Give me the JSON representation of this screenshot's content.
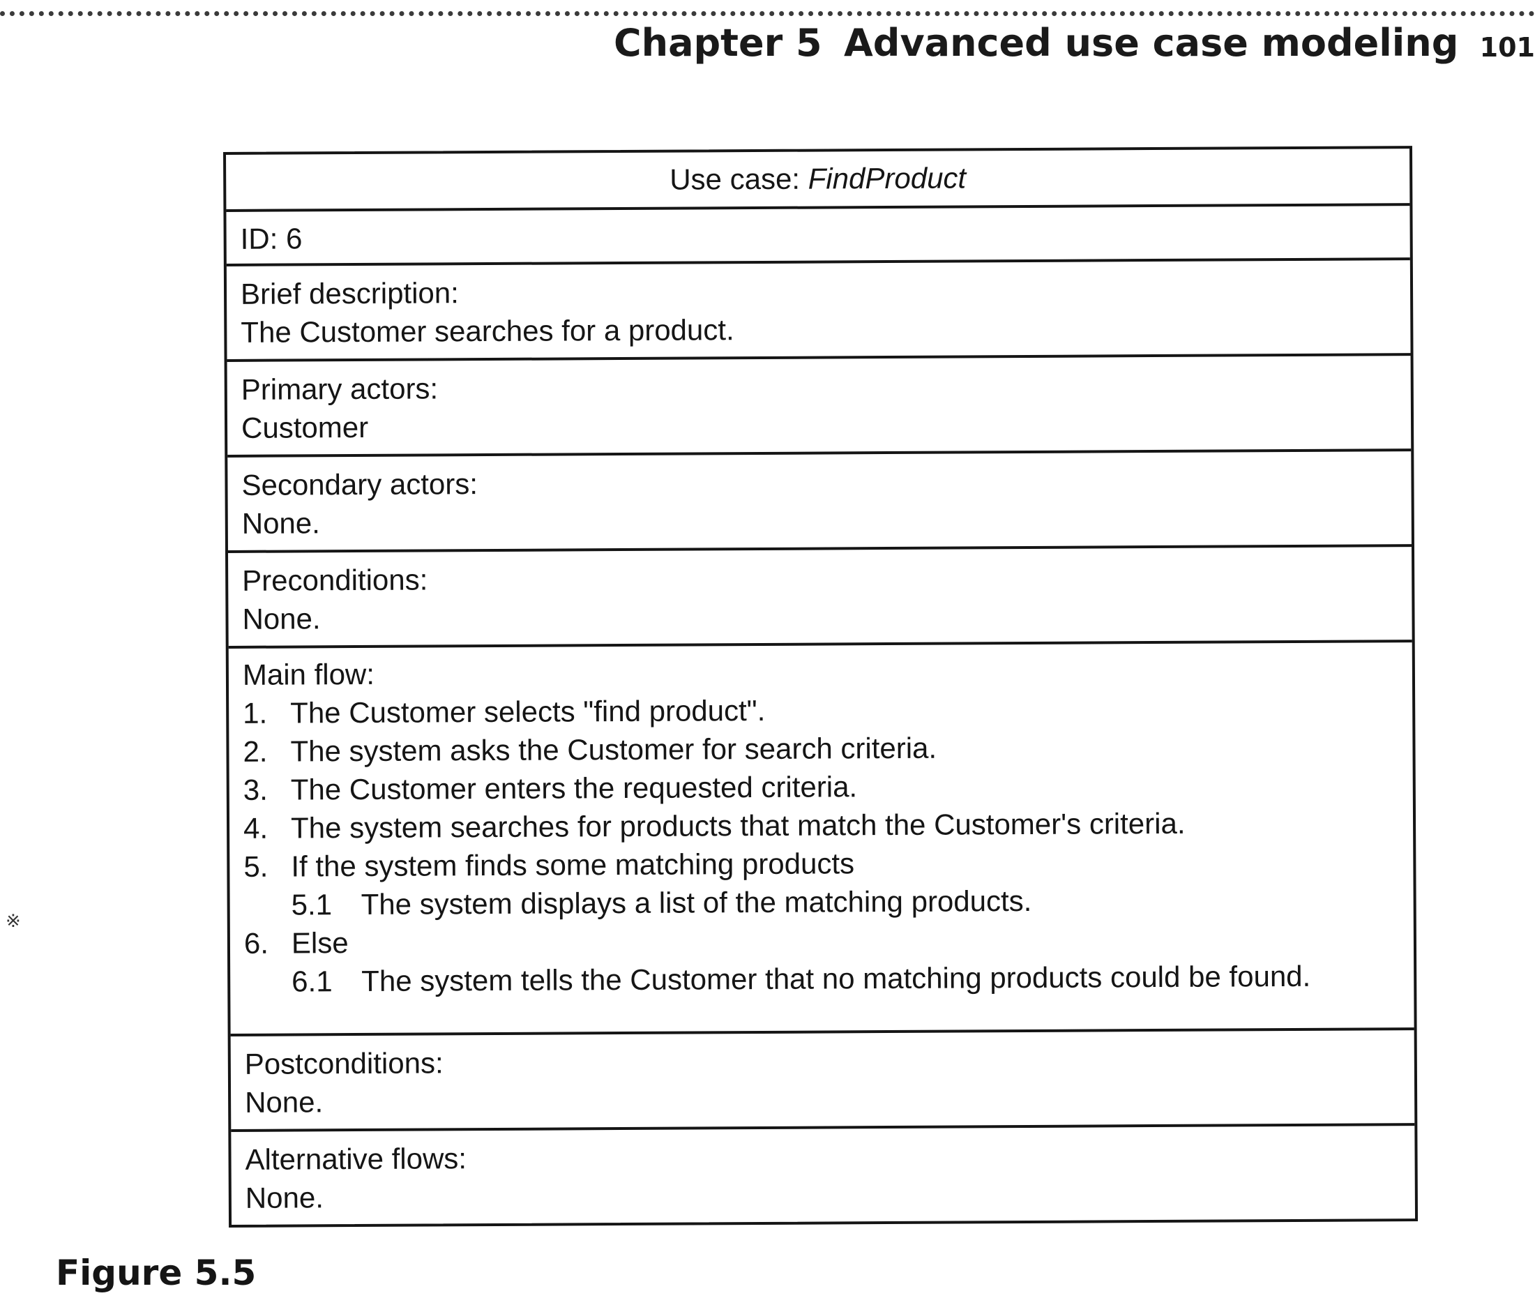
{
  "header": {
    "chapter": "Chapter 5",
    "title": "Advanced use case modeling",
    "page_number": "101"
  },
  "use_case": {
    "title_prefix": "Use case: ",
    "name": "FindProduct",
    "id": "ID: 6",
    "brief_description": {
      "label": "Brief description:",
      "value": "The Customer searches for a product."
    },
    "primary_actors": {
      "label": "Primary actors:",
      "value": "Customer"
    },
    "secondary_actors": {
      "label": "Secondary actors:",
      "value": "None."
    },
    "preconditions": {
      "label": "Preconditions:",
      "value": "None."
    },
    "main_flow": {
      "label": "Main flow:",
      "steps": [
        {
          "num": "1.",
          "text": "The Customer selects \"find product\"."
        },
        {
          "num": "2.",
          "text": "The system asks the Customer for search criteria."
        },
        {
          "num": "3.",
          "text": "The Customer enters the requested criteria."
        },
        {
          "num": "4.",
          "text": "The system searches for products that match the Customer's criteria."
        },
        {
          "num": "5.",
          "text": "If the system finds some matching products"
        },
        {
          "num": "5.1",
          "text": "The system displays a list of the matching products."
        },
        {
          "num": "6.",
          "text": "Else"
        },
        {
          "num": "6.1",
          "text": "The system tells the Customer that no matching products could be found."
        }
      ]
    },
    "postconditions": {
      "label": "Postconditions:",
      "value": "None."
    },
    "alternative_flows": {
      "label": "Alternative flows:",
      "value": "None."
    }
  },
  "caption": "Figure 5.5"
}
